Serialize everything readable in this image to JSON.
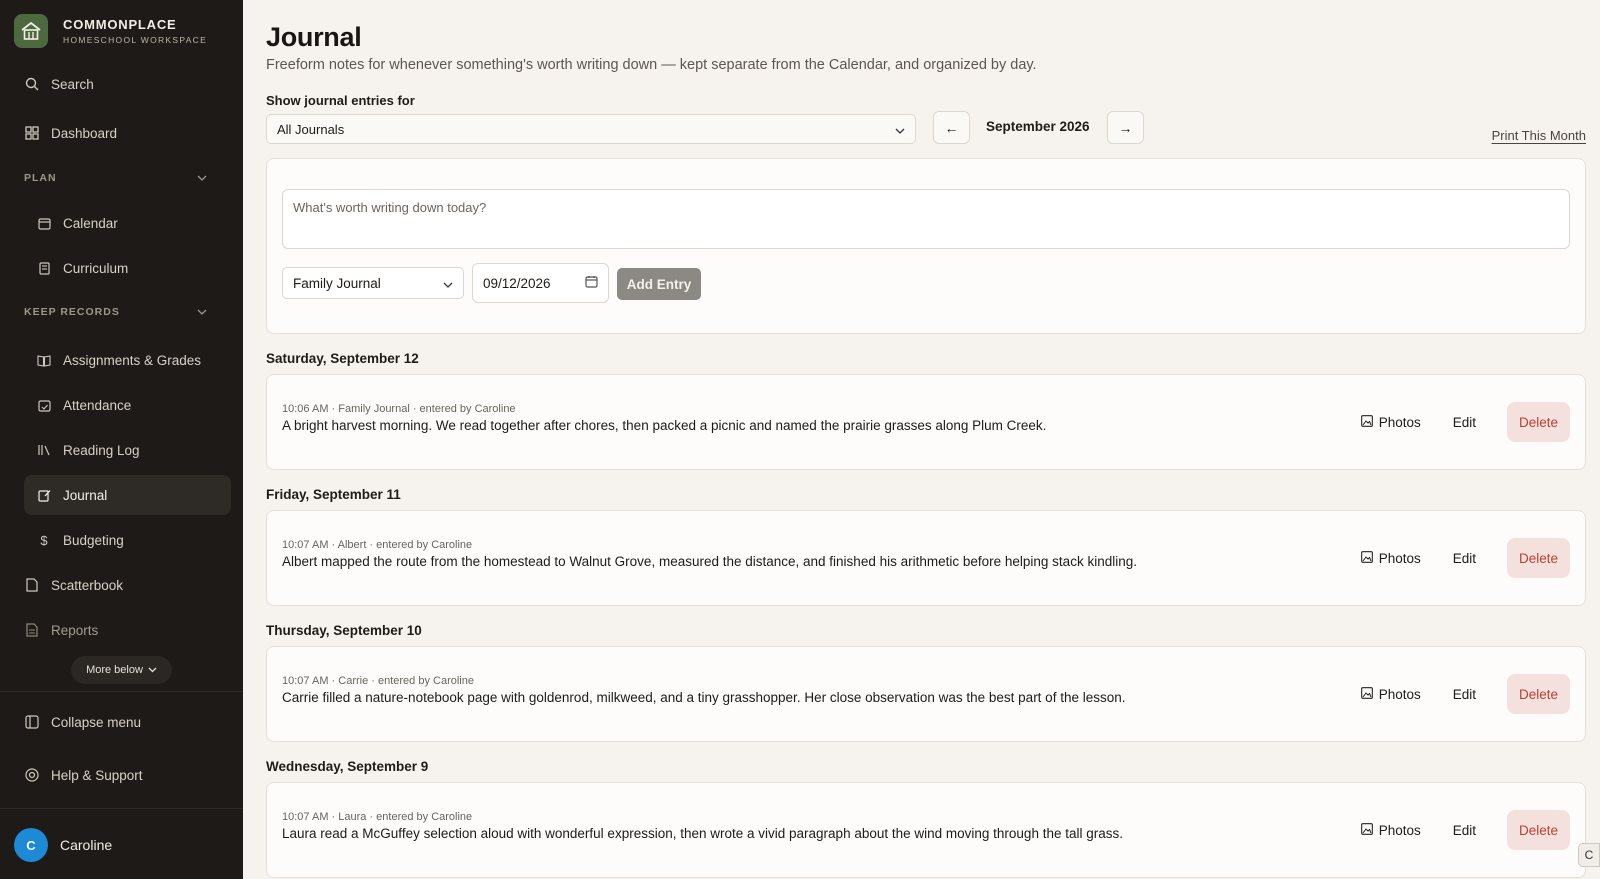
{
  "brand": {
    "name": "COMMONPLACE",
    "subtitle": "HOMESCHOOL WORKSPACE"
  },
  "sidebar": {
    "search": "Search",
    "dashboard": "Dashboard",
    "plan_section": "PLAN",
    "calendar": "Calendar",
    "curriculum": "Curriculum",
    "records_section": "KEEP RECORDS",
    "assignments": "Assignments & Grades",
    "attendance": "Attendance",
    "reading_log": "Reading Log",
    "journal": "Journal",
    "budgeting": "Budgeting",
    "scatterbook": "Scatterbook",
    "reports": "Reports",
    "more_below": "More below",
    "collapse": "Collapse menu",
    "help": "Help & Support"
  },
  "user": {
    "initial": "C",
    "name": "Caroline"
  },
  "header": {
    "title": "Journal",
    "subtitle": "Freeform notes for whenever something's worth writing down — kept separate from the Calendar, and organized by day."
  },
  "filter": {
    "label": "Show journal entries for",
    "selected": "All Journals",
    "prev": "←",
    "month": "September 2026",
    "next": "→",
    "print": "Print This Month"
  },
  "composer": {
    "placeholder": "What's worth writing down today?",
    "journal": "Family Journal",
    "date": "09/12/2026",
    "add": "Add Entry"
  },
  "entry_actions": {
    "photos": "Photos",
    "edit": "Edit",
    "delete": "Delete"
  },
  "days": [
    {
      "label": "Saturday, September 12",
      "meta": "10:06 AM · Family Journal · entered by Caroline",
      "text": "A bright harvest morning. We read together after chores, then packed a picnic and named the prairie grasses along Plum Creek."
    },
    {
      "label": "Friday, September 11",
      "meta": "10:07 AM · Albert · entered by Caroline",
      "text": "Albert mapped the route from the homestead to Walnut Grove, measured the distance, and finished his arithmetic before helping stack kindling."
    },
    {
      "label": "Thursday, September 10",
      "meta": "10:07 AM · Carrie · entered by Caroline",
      "text": "Carrie filled a nature-notebook page with goldenrod, milkweed, and a tiny grasshopper. Her close observation was the best part of the lesson."
    },
    {
      "label": "Wednesday, September 9",
      "meta": "10:07 AM · Laura · entered by Caroline",
      "text": "Laura read a McGuffey selection aloud with wonderful expression, then wrote a vivid paragraph about the wind moving through the tall grass."
    }
  ],
  "corner_tab": "C",
  "colors": {
    "sidebar": "#1d1a17",
    "page": "#f6f3ee",
    "logo": "#4d6a3f",
    "avatar": "#1e8ad6",
    "delete_bg": "#f4e1dd",
    "delete_text": "#bc3f33"
  },
  "icons": [
    "house-logo-icon",
    "search-icon",
    "dashboard-grid-icon",
    "chevron-down-icon",
    "calendar-icon",
    "curriculum-icon",
    "book-open-icon",
    "attendance-icon",
    "library-icon",
    "journal-edit-icon",
    "dollar-icon",
    "file-icon",
    "report-icon",
    "collapse-icon",
    "lifebuoy-icon",
    "image-icon"
  ]
}
